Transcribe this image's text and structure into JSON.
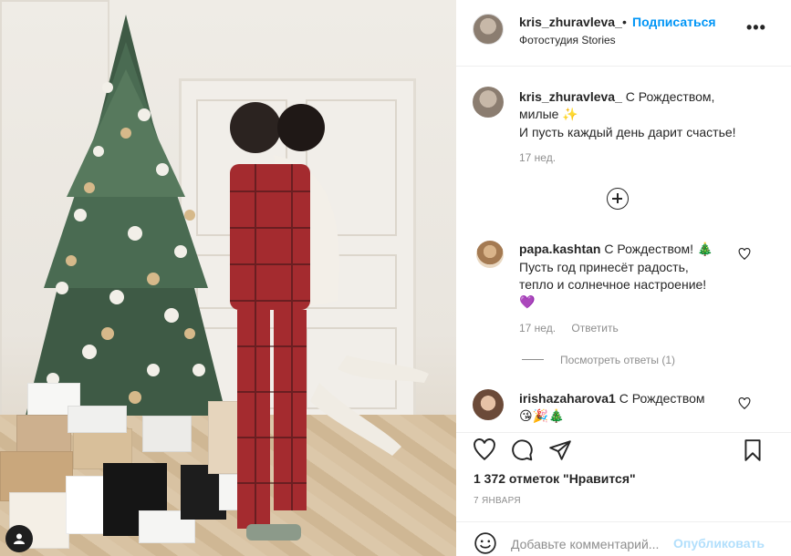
{
  "post": {
    "author": "kris_zhuravleva_",
    "separator": "•",
    "follow_label": "Подписаться",
    "location": "Фотостудия Stories",
    "more_label": "•••"
  },
  "caption": {
    "username": "kris_zhuravleva_",
    "line1": " С Рождеством,",
    "line2": "милые ",
    "line2_emoji": "✨",
    "line3": "И пусть каждый день дарит счастье!",
    "time": "17 нед."
  },
  "comments": [
    {
      "username": "papa.kashtan",
      "line1": " С Рождеством! ",
      "line1_emoji": "🎄",
      "line2": "Пусть год принесёт радость,",
      "line3": "тепло и солнечное настроение!",
      "line4_emoji": "💜",
      "time": "17 нед.",
      "reply_label": "Ответить",
      "view_replies": "Посмотреть ответы (1)"
    },
    {
      "username": "irishazaharova1",
      "line1": " С Рождеством",
      "line2_emoji": "😘🎉🎄"
    }
  ],
  "actions": {
    "likes": "1 372 отметок \"Нравится\"",
    "date": "7 ЯНВАРЯ"
  },
  "comment_box": {
    "placeholder": "Добавьте комментарий...",
    "publish_label": "Опубликовать"
  },
  "icons": {
    "heart": "heart-icon",
    "comment": "comment-icon",
    "share": "share-icon",
    "bookmark": "bookmark-icon",
    "emoji": "emoji-icon",
    "load_more": "plus-circle-icon"
  },
  "colors": {
    "link_blue": "#0095f6",
    "publish_disabled": "#b2dffc",
    "secondary_text": "#8e8e8e",
    "primary_text": "#262626"
  }
}
